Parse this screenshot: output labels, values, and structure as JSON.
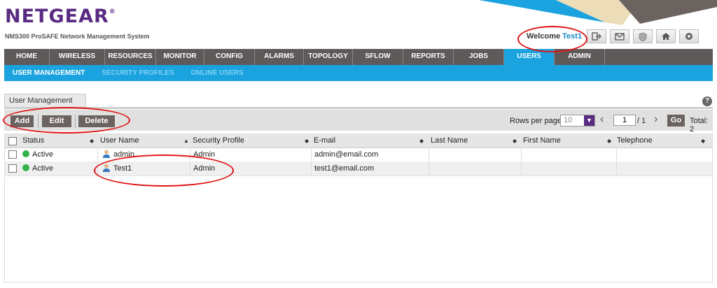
{
  "brand": {
    "logo": "NETGEAR",
    "reg": "®",
    "subtitle": "NMS300 ProSAFE Network Management System"
  },
  "welcome": {
    "prefix": "Welcome",
    "user": "Test1"
  },
  "header_icons": [
    "logout-icon",
    "mail-icon",
    "shield-icon",
    "home-icon",
    "settings-icon"
  ],
  "main_nav": [
    "HOME",
    "WIRELESS",
    "RESOURCES",
    "MONITOR",
    "CONFIG",
    "ALARMS",
    "TOPOLOGY",
    "SFLOW",
    "REPORTS",
    "JOBS",
    "USERS",
    "ADMIN"
  ],
  "active_nav": "USERS",
  "sub_nav": [
    "USER MANAGEMENT",
    "SECURITY PROFILES",
    "ONLINE USERS"
  ],
  "panel": {
    "title": "User Management",
    "help": "?"
  },
  "toolbar": {
    "add": "Add",
    "edit": "Edit",
    "delete": "Delete",
    "rows_per_page_label": "Rows per page",
    "rows_per_page_value": "10",
    "page_input": "1",
    "page_total": "/ 1",
    "go": "Go",
    "total": "Total: 2"
  },
  "table": {
    "columns": [
      "Status",
      "User Name",
      "Security Profile",
      "E-mail",
      "Last Name",
      "First Name",
      "Telephone"
    ],
    "rows": [
      {
        "status": "Active",
        "username": "admin",
        "profile": "Admin",
        "email": "admin@email.com",
        "last": "",
        "first": "",
        "phone": ""
      },
      {
        "status": "Active",
        "username": "Test1",
        "profile": "Admin",
        "email": "test1@email.com",
        "last": "",
        "first": "",
        "phone": ""
      }
    ]
  },
  "colors": {
    "brand_purple": "#5a2b82",
    "nav_gray": "#5e5a5a",
    "accent_blue": "#1aa3de",
    "active_green": "#31b34a",
    "annotation_red": "#e11414"
  }
}
